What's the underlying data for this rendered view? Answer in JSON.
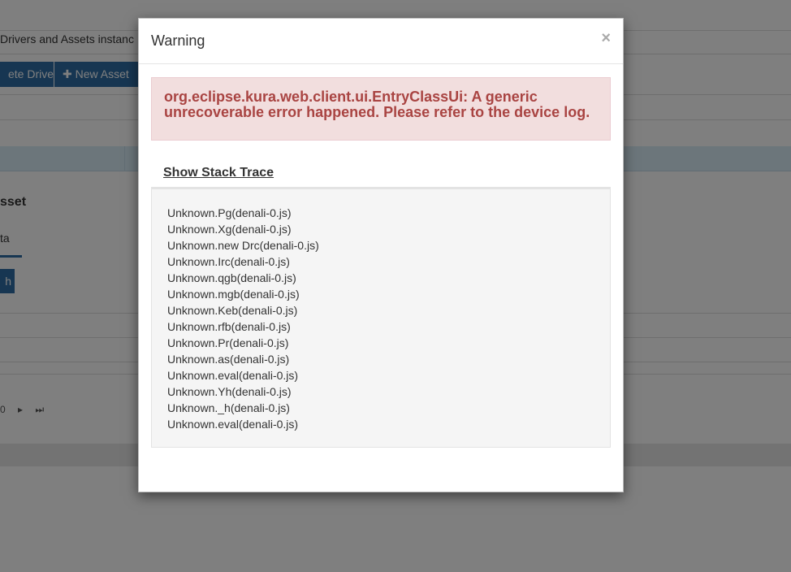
{
  "background": {
    "title": "Drivers and Assets instanc",
    "buttons": {
      "delete_driver": "ete Driver",
      "new_asset": "New Asset"
    },
    "section_heading": "sset",
    "tab_label": "ta",
    "small_button": "h",
    "pager": {
      "page": "0",
      "next": "▸",
      "last": "⏭"
    }
  },
  "modal": {
    "title": "Warning",
    "close": "×",
    "error_message": "org.eclipse.kura.web.client.ui.EntryClassUi: A generic unrecoverable error happened. Please refer to the device log.",
    "stack_toggle": "Show Stack Trace",
    "stack_trace": [
      "Unknown.Pg(denali-0.js)",
      "Unknown.Xg(denali-0.js)",
      "Unknown.new Drc(denali-0.js)",
      "Unknown.Irc(denali-0.js)",
      "Unknown.qgb(denali-0.js)",
      "Unknown.mgb(denali-0.js)",
      "Unknown.Keb(denali-0.js)",
      "Unknown.rfb(denali-0.js)",
      "Unknown.Pr(denali-0.js)",
      "Unknown.as(denali-0.js)",
      "Unknown.eval(denali-0.js)",
      "Unknown.Yh(denali-0.js)",
      "Unknown._h(denali-0.js)",
      "Unknown.eval(denali-0.js)"
    ]
  },
  "colors": {
    "primary": "#2e6da4",
    "alert_bg": "#f2dede",
    "alert_text": "#a94442",
    "trace_bg": "#f5f5f5"
  }
}
